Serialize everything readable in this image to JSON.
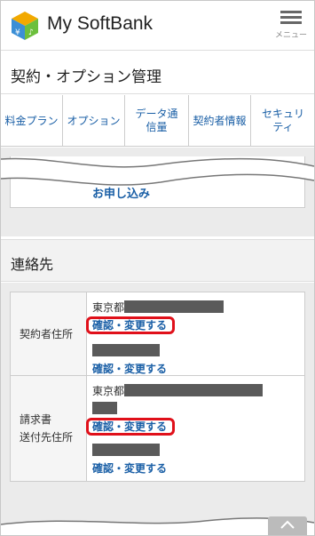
{
  "header": {
    "brand": "My SoftBank",
    "menu_label": "メニュー"
  },
  "page": {
    "title": "契約・オプション管理"
  },
  "tabs": [
    {
      "label": "料金プラン"
    },
    {
      "label": "オプション"
    },
    {
      "label": "データ通信量"
    },
    {
      "label": "契約者情報"
    },
    {
      "label": "セキュリティ"
    }
  ],
  "partial_card": {
    "link": "お申し込み"
  },
  "section": {
    "title": "連絡先"
  },
  "rows": [
    {
      "label": "契約者住所",
      "address_prefix": "東京都",
      "primary_link": "確認・変更する",
      "secondary_link": "確認・変更する"
    },
    {
      "label_line1": "請求書",
      "label_line2": "送付先住所",
      "address_prefix": "東京都",
      "primary_link": "確認・変更する",
      "secondary_link": "確認・変更する"
    }
  ],
  "colors": {
    "link": "#1a5fa6",
    "highlight": "#e0101a",
    "mask": "#5a5a5a"
  }
}
